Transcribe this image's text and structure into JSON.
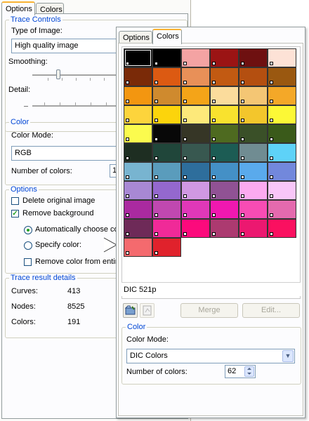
{
  "back_panel": {
    "tabs": [
      "Options",
      "Colors"
    ],
    "trace_controls": {
      "legend": "Trace Controls",
      "type_label": "Type of Image:",
      "type_value": "High quality image",
      "smoothing_label": "Smoothing:",
      "detail_label": "Detail:"
    },
    "color": {
      "legend": "Color",
      "mode_label": "Color Mode:",
      "mode_value": "RGB",
      "num_label": "Number of colors:",
      "num_value": "1"
    },
    "options": {
      "legend": "Options",
      "delete_original": "Delete original image",
      "delete_original_checked": false,
      "remove_background": "Remove background",
      "remove_background_checked": true,
      "auto_choose": "Automatically choose col",
      "specify_color": "Specify color:",
      "remove_entire": "Remove color from entire"
    },
    "details": {
      "legend": "Trace result details",
      "rows": [
        {
          "label": "Curves:",
          "value": "413"
        },
        {
          "label": "Nodes:",
          "value": "8525"
        },
        {
          "label": "Colors:",
          "value": "191"
        }
      ]
    }
  },
  "front_panel": {
    "tabs": [
      "Options",
      "Colors"
    ],
    "palette": [
      "#000000",
      "#000000",
      "#f4a3a3",
      "#9b1414",
      "#6e1010",
      "#fde2d6",
      "#7a2a08",
      "#dc5a12",
      "#e89058",
      "#c25a12",
      "#b44f10",
      "#9a5810",
      "#f39610",
      "#cf8a2e",
      "#f4a418",
      "#fbdc9c",
      "#f4c674",
      "#f4a828",
      "#fdd43c",
      "#fcd40c",
      "#fde97a",
      "#f9e22e",
      "#f3c62c",
      "#fcf836",
      "#fbfb4e",
      "#080808",
      "#363626",
      "#4e6a20",
      "#3a5028",
      "#3a5a1a",
      "#1e2e22",
      "#20463a",
      "#385850",
      "#1c5c54",
      "#708c92",
      "#5ed2f8",
      "#78b4d0",
      "#5a9cbc",
      "#2e6e9c",
      "#4490c6",
      "#5aaaec",
      "#7288dc",
      "#a888d4",
      "#9468ce",
      "#d098e2",
      "#905294",
      "#fcaaf0",
      "#f8c6f8",
      "#aa2aa0",
      "#c048b0",
      "#e038b8",
      "#f018b0",
      "#f84cb4",
      "#e46aae",
      "#6e2a58",
      "#f02a98",
      "#fc0a7c",
      "#ac3a70",
      "#ec1870",
      "#fa1060",
      "#f46a6e",
      "#e0222c"
    ],
    "selected_swatch": "DIC 521p",
    "buttons": {
      "merge": "Merge",
      "edit": "Edit..."
    },
    "color_group": {
      "legend": "Color",
      "mode_label": "Color Mode:",
      "mode_value": "DIC Colors",
      "num_label": "Number of colors:",
      "num_value": "62"
    }
  }
}
